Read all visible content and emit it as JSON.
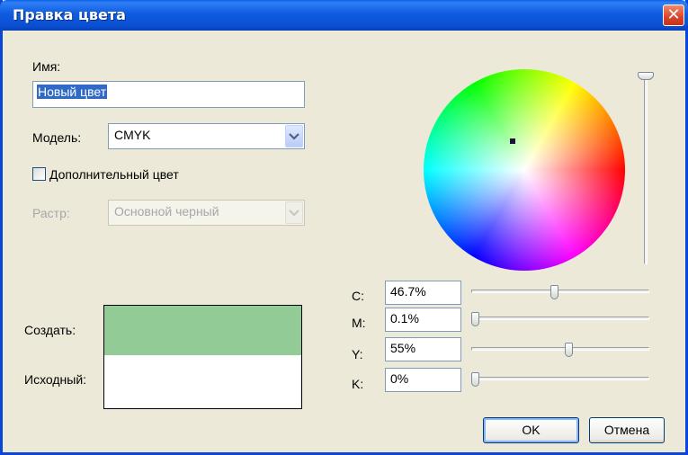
{
  "window": {
    "title": "Правка цвета",
    "close_glyph": "✕"
  },
  "form": {
    "name_label": "Имя:",
    "name_value": "Новый цвет",
    "model_label": "Модель:",
    "model_value": "CMYK",
    "spot_label": "Дополнительный цвет",
    "spot_checked": false,
    "screen_label": "Растр:",
    "screen_value": "Основной черный"
  },
  "preview": {
    "new_label": "Создать:",
    "original_label": "Исходный:",
    "new_color": "#93cb97",
    "original_color": "#ffffff"
  },
  "cmyk": [
    {
      "label": "C:",
      "value": "46.7%",
      "slider": 0.467
    },
    {
      "label": "M:",
      "value": "0.1%",
      "slider": 0.001
    },
    {
      "label": "Y:",
      "value": "55%",
      "slider": 0.55
    },
    {
      "label": "K:",
      "value": "0%",
      "slider": 0.0
    }
  ],
  "brightness_slider": 1.0,
  "buttons": {
    "ok": "OK",
    "cancel": "Отмена"
  },
  "icons": {
    "close": "close-icon",
    "dropdown": "chevron-down-icon"
  }
}
